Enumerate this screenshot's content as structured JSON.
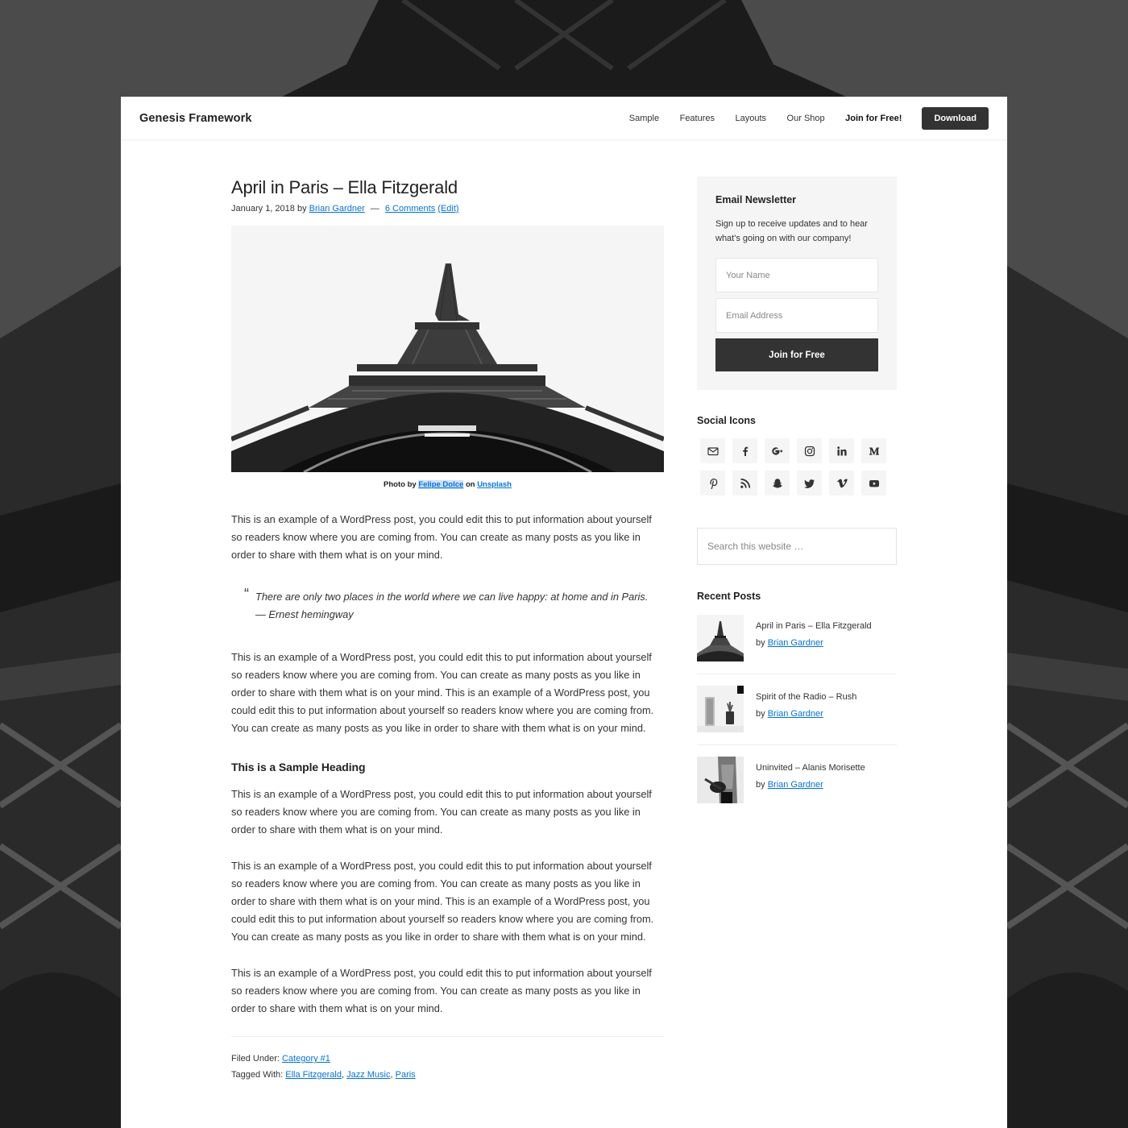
{
  "header": {
    "site_title": "Genesis Framework",
    "nav": [
      {
        "label": "Sample"
      },
      {
        "label": "Features"
      },
      {
        "label": "Layouts"
      },
      {
        "label": "Our Shop"
      },
      {
        "label": "Join for Free!"
      }
    ],
    "download_label": "Download"
  },
  "post": {
    "title": "April in Paris – Ella Fitzgerald",
    "date": "January 1, 2018",
    "by": "by",
    "author": "Brian Gardner",
    "sep": "—",
    "comments": "6 Comments",
    "edit": "(Edit)",
    "image_icon": "eiffel-tower-photo",
    "caption": {
      "prefix": "Photo by",
      "photographer": "Felipe Dolce",
      "on": "on",
      "source": "Unsplash"
    },
    "paragraph_1": "This is an example of a WordPress post, you could edit this to put information about yourself so readers know where you are coming from. You can create as many posts as you like in order to share with them what is on your mind.",
    "quote_mark": "“",
    "quote_text": "There are only two places in the world where we can live happy: at home and in Paris.",
    "quote_cite": "— Ernest hemingway",
    "paragraph_2": "This is an example of a WordPress post, you could edit this to put information about yourself so readers know where you are coming from. You can create as many posts as you like in order to share with them what is on your mind. This is an example of a WordPress post, you could edit this to put information about yourself so readers know where you are coming from. You can create as many posts as you like in order to share with them what is on your mind.",
    "heading": "This is a Sample Heading",
    "paragraph_3": "This is an example of a WordPress post, you could edit this to put information about yourself so readers know where you are coming from. You can create as many posts as you like in order to share with them what is on your mind.",
    "paragraph_4": "This is an example of a WordPress post, you could edit this to put information about yourself so readers know where you are coming from. You can create as many posts as you like in order to share with them what is on your mind. This is an example of a WordPress post, you could edit this to put information about yourself so readers know where you are coming from. You can create as many posts as you like in order to share with them what is on your mind.",
    "paragraph_5": "This is an example of a WordPress post, you could edit this to put information about yourself so readers know where you are coming from. You can create as many posts as you like in order to share with them what is on your mind.",
    "filed_under_label": "Filed Under:",
    "category": "Category #1",
    "tagged_label": "Tagged With:",
    "tags": [
      "Ella Fitzgerald",
      "Jazz Music",
      "Paris"
    ],
    "tag_sep": ", "
  },
  "sidebar": {
    "newsletter": {
      "title": "Email Newsletter",
      "text": "Sign up to receive updates and to hear what's going on with our company!",
      "name_placeholder": "Your Name",
      "email_placeholder": "Email Address",
      "button": "Join for Free"
    },
    "social": {
      "title": "Social Icons",
      "icons": [
        "email",
        "facebook",
        "google-plus",
        "instagram",
        "linkedin",
        "medium",
        "pinterest",
        "rss",
        "snapchat",
        "twitter",
        "vimeo",
        "youtube"
      ]
    },
    "search_placeholder": "Search this website …",
    "recent": {
      "title": "Recent Posts",
      "posts": [
        {
          "title": "April in Paris – Ella Fitzgerald",
          "by": "by",
          "author": "Brian Gardner",
          "thumb": "eiffel-tower"
        },
        {
          "title": "Spirit of the Radio – Rush",
          "by": "by",
          "author": "Brian Gardner",
          "thumb": "speaker-and-plant"
        },
        {
          "title": "Uninvited – Alanis Morisette",
          "by": "by",
          "author": "Brian Gardner",
          "thumb": "guitarist"
        }
      ]
    }
  },
  "colors": {
    "link": "#0073e5",
    "button": "#333333",
    "widget_bg": "#f5f5f5",
    "page_bg": "#4a4a4a"
  }
}
